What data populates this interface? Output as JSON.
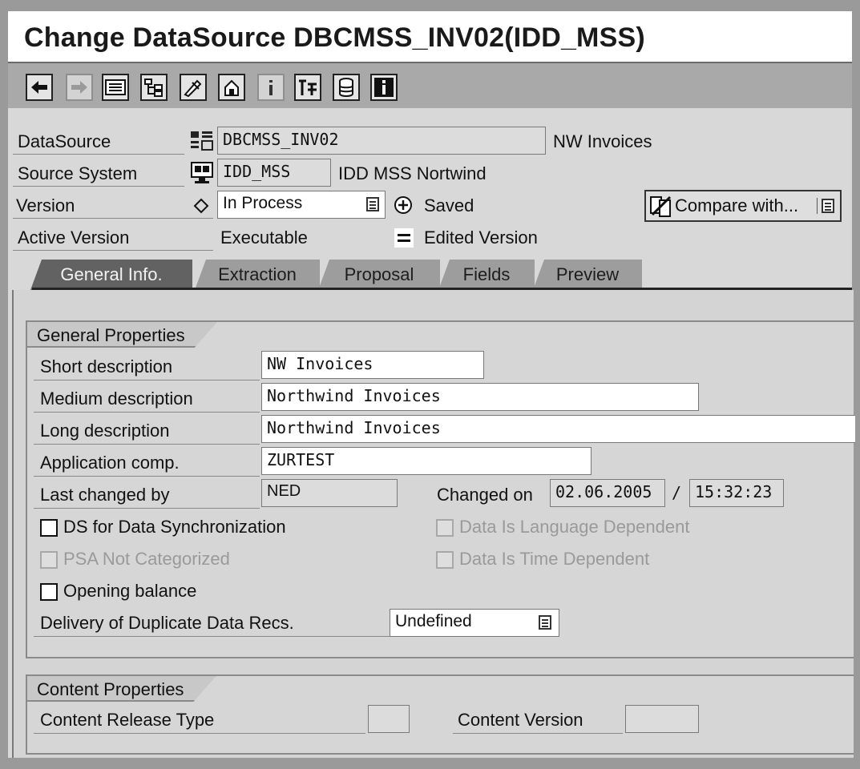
{
  "window": {
    "title": "Change DataSource DBCMSS_INV02(IDD_MSS)"
  },
  "toolbar": {
    "buttons": [
      {
        "name": "back-icon"
      },
      {
        "name": "forward-icon"
      },
      {
        "name": "display-change-icon"
      },
      {
        "name": "hierarchy-icon"
      },
      {
        "name": "check-icon"
      },
      {
        "name": "activate-icon"
      },
      {
        "name": "info-icon"
      },
      {
        "name": "technical-settings-icon"
      },
      {
        "name": "database-icon"
      },
      {
        "name": "information-icon"
      }
    ]
  },
  "header": {
    "datasource": {
      "label": "DataSource",
      "value": "DBCMSS_INV02",
      "desc": "NW Invoices"
    },
    "source_system": {
      "label": "Source System",
      "value": "IDD_MSS",
      "desc": "IDD MSS Nortwind"
    },
    "version": {
      "label": "Version",
      "value": "In Process",
      "status": "Saved"
    },
    "compare_button": "Compare with...",
    "active_version": {
      "label": "Active Version",
      "value": "Executable",
      "status": "Edited Version"
    }
  },
  "tabs": [
    {
      "label": "General Info.",
      "active": true
    },
    {
      "label": "Extraction",
      "active": false
    },
    {
      "label": "Proposal",
      "active": false
    },
    {
      "label": "Fields",
      "active": false
    },
    {
      "label": "Preview",
      "active": false
    }
  ],
  "general": {
    "title": "General Properties",
    "short_desc": {
      "label": "Short description",
      "value": "NW Invoices"
    },
    "medium_desc": {
      "label": "Medium description",
      "value": "Northwind Invoices"
    },
    "long_desc": {
      "label": "Long description",
      "value": "Northwind Invoices"
    },
    "app_comp": {
      "label": "Application comp.",
      "value": "ZURTEST"
    },
    "last_changed": {
      "label": "Last changed by",
      "value": "NED"
    },
    "changed_on": {
      "label": "Changed on",
      "date": "02.06.2005",
      "sep": "/",
      "time": "15:32:23"
    },
    "ds_sync": {
      "label": "DS for Data Synchronization",
      "checked": false
    },
    "lang_dep": {
      "label": "Data Is Language Dependent",
      "checked": false
    },
    "psa": {
      "label": "PSA Not Categorized",
      "checked": false
    },
    "time_dep": {
      "label": "Data Is Time Dependent",
      "checked": false
    },
    "opening": {
      "label": "Opening balance",
      "checked": false
    },
    "delivery": {
      "label": "Delivery of Duplicate Data Recs.",
      "value": "Undefined"
    }
  },
  "content": {
    "title": "Content Properties",
    "release_type": {
      "label": "Content Release Type",
      "value": ""
    },
    "version": {
      "label": "Content Version",
      "value": ""
    }
  }
}
